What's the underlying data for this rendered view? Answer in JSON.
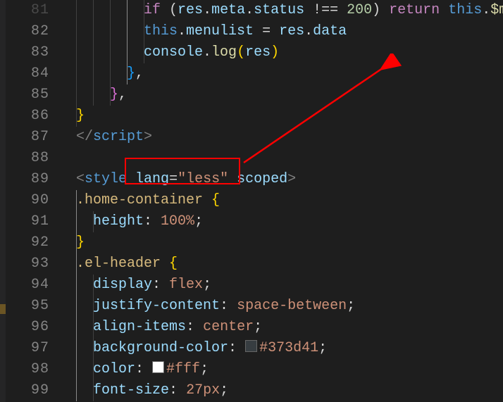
{
  "gutter": {
    "start": 81,
    "end": 99,
    "visible_lines": [
      81,
      82,
      83,
      84,
      85,
      86,
      87,
      88,
      89,
      90,
      91,
      92,
      93,
      94,
      95,
      96,
      97,
      98,
      99
    ],
    "dim_first": true
  },
  "code": {
    "lines": {
      "81": {
        "indent_guides": [
          0,
          24,
          48,
          72,
          96
        ],
        "active_guide": 72,
        "segments": [
          {
            "text": "        ",
            "cls": ""
          },
          {
            "text": "if",
            "cls": "tok-control"
          },
          {
            "text": " (",
            "cls": "tok-default"
          },
          {
            "text": "res",
            "cls": "tok-var"
          },
          {
            "text": ".",
            "cls": "tok-default"
          },
          {
            "text": "meta",
            "cls": "tok-var"
          },
          {
            "text": ".",
            "cls": "tok-default"
          },
          {
            "text": "status",
            "cls": "tok-var"
          },
          {
            "text": " !== ",
            "cls": "tok-default"
          },
          {
            "text": "200",
            "cls": "tok-num"
          },
          {
            "text": ") ",
            "cls": "tok-default"
          },
          {
            "text": "return",
            "cls": "tok-control"
          },
          {
            "text": " ",
            "cls": "tok-default"
          },
          {
            "text": "this",
            "cls": "tok-keyword"
          },
          {
            "text": ".",
            "cls": "tok-default"
          },
          {
            "text": "$me",
            "cls": "tok-func"
          }
        ]
      },
      "82": {
        "indent_guides": [
          0,
          24,
          48,
          72,
          96
        ],
        "active_guide": 72,
        "segments": [
          {
            "text": "        ",
            "cls": ""
          },
          {
            "text": "this",
            "cls": "tok-keyword"
          },
          {
            "text": ".",
            "cls": "tok-default"
          },
          {
            "text": "menulist",
            "cls": "tok-var"
          },
          {
            "text": " = ",
            "cls": "tok-default"
          },
          {
            "text": "res",
            "cls": "tok-var"
          },
          {
            "text": ".",
            "cls": "tok-default"
          },
          {
            "text": "data",
            "cls": "tok-var"
          }
        ]
      },
      "83": {
        "indent_guides": [
          0,
          24,
          48,
          72,
          96
        ],
        "active_guide": 72,
        "segments": [
          {
            "text": "        ",
            "cls": ""
          },
          {
            "text": "console",
            "cls": "tok-var"
          },
          {
            "text": ".",
            "cls": "tok-default"
          },
          {
            "text": "log",
            "cls": "tok-func"
          },
          {
            "text": "(",
            "cls": "tok-yellowbrace"
          },
          {
            "text": "res",
            "cls": "tok-var"
          },
          {
            "text": ")",
            "cls": "tok-yellowbrace"
          }
        ]
      },
      "84": {
        "indent_guides": [
          0,
          24,
          48,
          72
        ],
        "active_guide": 72,
        "segments": [
          {
            "text": "      ",
            "cls": ""
          },
          {
            "text": "}",
            "cls": "tok-bluebrace"
          },
          {
            "text": ",",
            "cls": "tok-default"
          }
        ]
      },
      "85": {
        "indent_guides": [
          0,
          24,
          48
        ],
        "segments": [
          {
            "text": "    ",
            "cls": ""
          },
          {
            "text": "}",
            "cls": "tok-purplebrace"
          },
          {
            "text": ",",
            "cls": "tok-default"
          }
        ]
      },
      "86": {
        "indent_guides": [
          0
        ],
        "segments": [
          {
            "text": "}",
            "cls": "tok-yellowbrace"
          }
        ]
      },
      "87": {
        "indent_guides": [],
        "segments": [
          {
            "text": "</",
            "cls": "tok-tagpunct"
          },
          {
            "text": "script",
            "cls": "tok-tag"
          },
          {
            "text": ">",
            "cls": "tok-tagpunct"
          }
        ]
      },
      "88": {
        "indent_guides": [],
        "segments": [
          {
            "text": "",
            "cls": ""
          }
        ]
      },
      "89": {
        "indent_guides": [],
        "segments": [
          {
            "text": "<",
            "cls": "tok-tagpunct"
          },
          {
            "text": "style",
            "cls": "tok-tag"
          },
          {
            "text": " ",
            "cls": ""
          },
          {
            "text": "lang",
            "cls": "tok-attr"
          },
          {
            "text": "=",
            "cls": "tok-default"
          },
          {
            "text": "\"less\"",
            "cls": "tok-str"
          },
          {
            "text": " ",
            "cls": ""
          },
          {
            "text": "scoped",
            "cls": "tok-attr"
          },
          {
            "text": ">",
            "cls": "tok-tagpunct"
          }
        ]
      },
      "90": {
        "indent_guides": [
          0
        ],
        "active_guide": 0,
        "segments": [
          {
            "text": ".home-container",
            "cls": "tok-selector"
          },
          {
            "text": " ",
            "cls": ""
          },
          {
            "text": "{",
            "cls": "tok-yellowbrace"
          }
        ]
      },
      "91": {
        "indent_guides": [
          0,
          24
        ],
        "active_guide": 0,
        "segments": [
          {
            "text": "  ",
            "cls": ""
          },
          {
            "text": "height",
            "cls": "tok-cssprop"
          },
          {
            "text": ": ",
            "cls": "tok-default"
          },
          {
            "text": "100%",
            "cls": "tok-cssval"
          },
          {
            "text": ";",
            "cls": "tok-default"
          }
        ]
      },
      "92": {
        "indent_guides": [
          0
        ],
        "active_guide": 0,
        "segments": [
          {
            "text": "}",
            "cls": "tok-yellowbrace"
          }
        ]
      },
      "93": {
        "indent_guides": [
          0
        ],
        "active_guide": 0,
        "segments": [
          {
            "text": ".el-header",
            "cls": "tok-selector"
          },
          {
            "text": " ",
            "cls": ""
          },
          {
            "text": "{",
            "cls": "tok-yellowbrace"
          }
        ]
      },
      "94": {
        "indent_guides": [
          0,
          24
        ],
        "active_guide": 0,
        "segments": [
          {
            "text": "  ",
            "cls": ""
          },
          {
            "text": "display",
            "cls": "tok-cssprop"
          },
          {
            "text": ": ",
            "cls": "tok-default"
          },
          {
            "text": "flex",
            "cls": "tok-cssval"
          },
          {
            "text": ";",
            "cls": "tok-default"
          }
        ]
      },
      "95": {
        "indent_guides": [
          0,
          24
        ],
        "active_guide": 0,
        "segments": [
          {
            "text": "  ",
            "cls": ""
          },
          {
            "text": "justify-content",
            "cls": "tok-cssprop"
          },
          {
            "text": ": ",
            "cls": "tok-default"
          },
          {
            "text": "space-between",
            "cls": "tok-cssval"
          },
          {
            "text": ";",
            "cls": "tok-default"
          }
        ]
      },
      "96": {
        "indent_guides": [
          0,
          24
        ],
        "active_guide": 0,
        "segments": [
          {
            "text": "  ",
            "cls": ""
          },
          {
            "text": "align-items",
            "cls": "tok-cssprop"
          },
          {
            "text": ": ",
            "cls": "tok-default"
          },
          {
            "text": "center",
            "cls": "tok-cssval"
          },
          {
            "text": ";",
            "cls": "tok-default"
          }
        ]
      },
      "97": {
        "indent_guides": [
          0,
          24
        ],
        "active_guide": 0,
        "segments": [
          {
            "text": "  ",
            "cls": ""
          },
          {
            "text": "background-color",
            "cls": "tok-cssprop"
          },
          {
            "text": ": ",
            "cls": "tok-default"
          },
          {
            "swatch": "#373d41"
          },
          {
            "text": "#373d41",
            "cls": "tok-cssval"
          },
          {
            "text": ";",
            "cls": "tok-default"
          }
        ]
      },
      "98": {
        "indent_guides": [
          0,
          24
        ],
        "active_guide": 0,
        "segments": [
          {
            "text": "  ",
            "cls": ""
          },
          {
            "text": "color",
            "cls": "tok-cssprop"
          },
          {
            "text": ": ",
            "cls": "tok-default"
          },
          {
            "swatch": "#ffffff"
          },
          {
            "text": "#fff",
            "cls": "tok-cssval"
          },
          {
            "text": ";",
            "cls": "tok-default"
          }
        ]
      },
      "99": {
        "indent_guides": [
          0,
          24
        ],
        "active_guide": 0,
        "segments": [
          {
            "text": "  ",
            "cls": ""
          },
          {
            "text": "font-size",
            "cls": "tok-cssprop"
          },
          {
            "text": ": ",
            "cls": "tok-default"
          },
          {
            "text": "27px",
            "cls": "tok-cssval"
          },
          {
            "text": ";",
            "cls": "tok-default"
          }
        ]
      }
    }
  },
  "annotation": {
    "box_label": "lang=\"less\"",
    "arrow_color": "#ff0000"
  }
}
